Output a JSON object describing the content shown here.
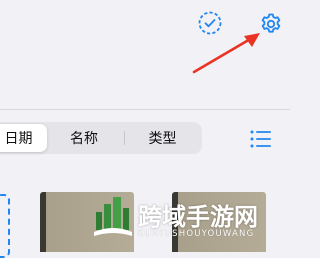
{
  "toolbar": {
    "select_icon": "checkmark-circle-dashed-icon",
    "settings_icon": "gear-icon"
  },
  "annotation": {
    "arrow_color": "#ea3323"
  },
  "sort_control": {
    "options": [
      "日期",
      "名称",
      "类型"
    ],
    "selected": "日期"
  },
  "view_toggle_icon": "list-icon",
  "accent_color": "#1f86f2",
  "watermark": {
    "title": "跨域手游网",
    "subtitle": "KUAYUSHOUYOUWANG"
  }
}
